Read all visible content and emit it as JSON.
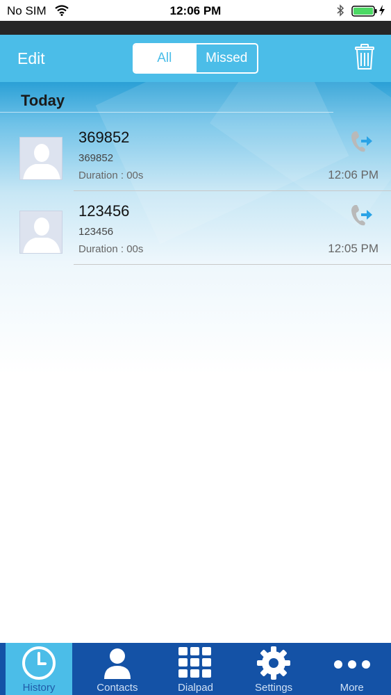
{
  "status_bar": {
    "carrier": "No SIM",
    "time": "12:06 PM"
  },
  "nav": {
    "edit_label": "Edit",
    "segments": [
      "All",
      "Missed"
    ],
    "selected_segment": "All"
  },
  "section": {
    "title": "Today"
  },
  "calls": [
    {
      "name": "369852",
      "number": "369852",
      "duration": "Duration : 00s",
      "time": "12:06 PM",
      "direction": "outgoing"
    },
    {
      "name": "123456",
      "number": "123456",
      "duration": "Duration : 00s",
      "time": "12:05 PM",
      "direction": "outgoing"
    }
  ],
  "tabs": [
    {
      "label": "History",
      "icon": "clock-icon",
      "active": true
    },
    {
      "label": "Contacts",
      "icon": "person-icon",
      "active": false
    },
    {
      "label": "Dialpad",
      "icon": "dialpad-icon",
      "active": false
    },
    {
      "label": "Settings",
      "icon": "gear-icon",
      "active": false
    },
    {
      "label": "More",
      "icon": "more-dots-icon",
      "active": false
    }
  ],
  "colors": {
    "accent": "#4bbde8",
    "tabbar": "#1452a6",
    "call_arrow": "#2aa3e6"
  }
}
